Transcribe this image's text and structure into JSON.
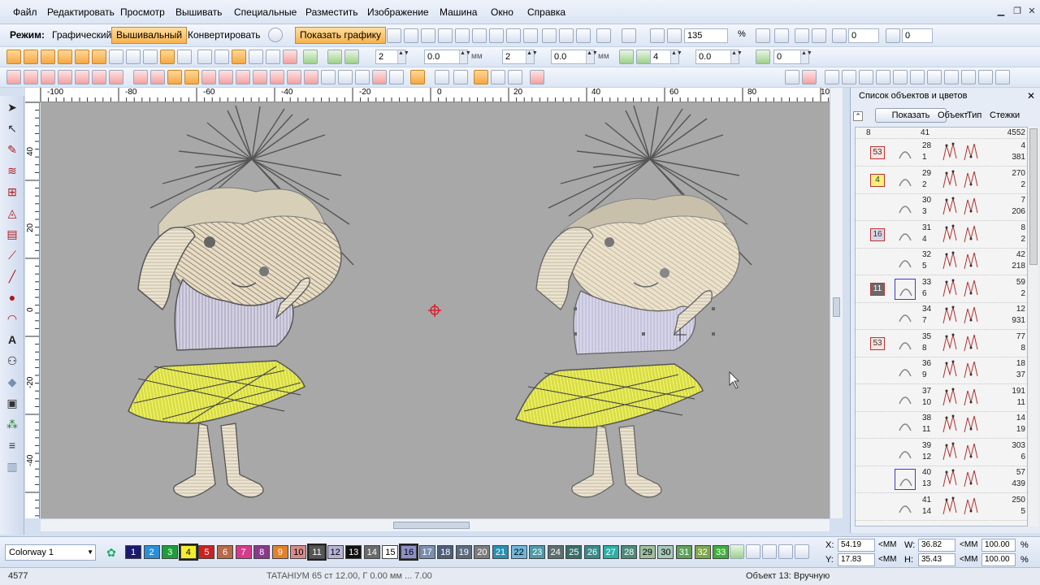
{
  "menu": {
    "items": [
      "Файл",
      "Редактировать",
      "Просмотр",
      "Вышивать",
      "Специальные",
      "Разместить",
      "Изображение",
      "Машина",
      "Окно",
      "Справка"
    ]
  },
  "toolbar": {
    "mode_label": "Режим:",
    "mode_graphic": "Графический",
    "mode_embroidery": "Вышивальный",
    "mode_convert": "Конвертировать",
    "show_graphic": "Показать графику",
    "zoom_value": "135",
    "zoom_unit": "%",
    "rotate_value": "0",
    "slant_value": "0",
    "field_a": "2",
    "field_b": "0.0",
    "unit_mm": "мм",
    "field_c": "2",
    "field_d": "0.0",
    "field_e": "4",
    "field_f": "0.0",
    "field_g": "0"
  },
  "ruler": {
    "h_labels": [
      "-100",
      "-80",
      "-60",
      "-40",
      "-20",
      "0",
      "20",
      "40",
      "60",
      "80",
      "100"
    ],
    "v_labels": [
      "40",
      "20",
      "0",
      "-20",
      "-40"
    ]
  },
  "panel": {
    "title": "Список объектов и цветов",
    "show_button": "Показать",
    "col_object": "Объект",
    "col_type": "Тип",
    "col_stitches": "Стежки",
    "first_row_num": "8",
    "first_row_count": "41",
    "first_row_stitches": "4552",
    "rows": [
      {
        "group": "53",
        "obj": "28",
        "sub": "1",
        "st1": "4",
        "st2": "381"
      },
      {
        "group": "4",
        "obj": "29",
        "sub": "2",
        "st1": "270",
        "st2": "2"
      },
      {
        "group": "",
        "obj": "30",
        "sub": "3",
        "st1": "7",
        "st2": "206"
      },
      {
        "group": "16",
        "obj": "31",
        "sub": "4",
        "st1": "8",
        "st2": "2"
      },
      {
        "group": "",
        "obj": "32",
        "sub": "5",
        "st1": "42",
        "st2": "218"
      },
      {
        "group": "11",
        "obj": "33",
        "sub": "6",
        "st1": "59",
        "st2": "2"
      },
      {
        "group": "",
        "obj": "34",
        "sub": "7",
        "st1": "12",
        "st2": "931"
      },
      {
        "group": "53",
        "obj": "35",
        "sub": "8",
        "st1": "77",
        "st2": "8"
      },
      {
        "group": "",
        "obj": "36",
        "sub": "9",
        "st1": "18",
        "st2": "37"
      },
      {
        "group": "",
        "obj": "37",
        "sub": "10",
        "st1": "191",
        "st2": "11"
      },
      {
        "group": "",
        "obj": "38",
        "sub": "11",
        "st1": "14",
        "st2": "19"
      },
      {
        "group": "",
        "obj": "39",
        "sub": "12",
        "st1": "303",
        "st2": "6"
      },
      {
        "group": "",
        "obj": "40",
        "sub": "13",
        "st1": "57",
        "st2": "439"
      },
      {
        "group": "",
        "obj": "41",
        "sub": "14",
        "st1": "250",
        "st2": "5"
      }
    ]
  },
  "palette": {
    "colorway": "Colorway 1",
    "swatches": [
      {
        "n": "1",
        "color": "#1c1a6e",
        "text": "#ffffff"
      },
      {
        "n": "2",
        "color": "#2a8fd6",
        "text": "#ffffff"
      },
      {
        "n": "3",
        "color": "#1f9d3a",
        "text": "#ffffff"
      },
      {
        "n": "4",
        "color": "#f2ef2a",
        "text": "#000000"
      },
      {
        "n": "5",
        "color": "#cc2222",
        "text": "#ffffff"
      },
      {
        "n": "6",
        "color": "#b86a4a",
        "text": "#ffffff"
      },
      {
        "n": "7",
        "color": "#d63b8a",
        "text": "#ffffff"
      },
      {
        "n": "8",
        "color": "#8a3a8a",
        "text": "#ffffff"
      },
      {
        "n": "9",
        "color": "#e3822a",
        "text": "#ffffff"
      },
      {
        "n": "10",
        "color": "#d88a8a",
        "text": "#000000"
      },
      {
        "n": "11",
        "color": "#555555",
        "text": "#ffffff"
      },
      {
        "n": "12",
        "color": "#b7b2d6",
        "text": "#000000"
      },
      {
        "n": "13",
        "color": "#111111",
        "text": "#ffffff"
      },
      {
        "n": "14",
        "color": "#6a6a6a",
        "text": "#ffffff"
      },
      {
        "n": "15",
        "color": "#ffffff",
        "text": "#000000"
      },
      {
        "n": "16",
        "color": "#8d8fc8",
        "text": "#000000"
      },
      {
        "n": "17",
        "color": "#7a8fb0",
        "text": "#ffffff"
      },
      {
        "n": "18",
        "color": "#4d5e7a",
        "text": "#ffffff"
      },
      {
        "n": "19",
        "color": "#5c6a80",
        "text": "#ffffff"
      },
      {
        "n": "20",
        "color": "#7c7c7c",
        "text": "#ffffff"
      },
      {
        "n": "21",
        "color": "#2a8fb0",
        "text": "#ffffff"
      },
      {
        "n": "22",
        "color": "#6fb8dc",
        "text": "#000000"
      },
      {
        "n": "23",
        "color": "#4c9aa8",
        "text": "#ffffff"
      },
      {
        "n": "24",
        "color": "#5e6e6e",
        "text": "#ffffff"
      },
      {
        "n": "25",
        "color": "#3a6e6a",
        "text": "#ffffff"
      },
      {
        "n": "26",
        "color": "#3a8a8a",
        "text": "#ffffff"
      },
      {
        "n": "27",
        "color": "#2ab0a8",
        "text": "#ffffff"
      },
      {
        "n": "28",
        "color": "#4c8a7a",
        "text": "#ffffff"
      },
      {
        "n": "29",
        "color": "#9fbfa0",
        "text": "#000000"
      },
      {
        "n": "30",
        "color": "#a8c8b8",
        "text": "#000000"
      },
      {
        "n": "31",
        "color": "#5fa05a",
        "text": "#ffffff"
      },
      {
        "n": "32",
        "color": "#7fa84a",
        "text": "#ffffff"
      },
      {
        "n": "33",
        "color": "#3fae3a",
        "text": "#ffffff"
      }
    ]
  },
  "coords": {
    "x_label": "X:",
    "x_value": "54.19",
    "x_unit": "<MM",
    "w_label": "W:",
    "w_value": "36.82",
    "w_unit": "<MM",
    "w_pct": "100.00",
    "pct_unit": "%",
    "y_label": "Y:",
    "y_value": "17.83",
    "y_unit": "<MM",
    "h_label": "H:",
    "h_value": "35.43",
    "h_unit": "<MM",
    "h_pct": "100.00"
  },
  "status": {
    "count": "4577",
    "thread_info": "TATAHIУM 65 ст 12.00, Г 0.00 мм ... 7.00",
    "object_info": "Объект 13: Вручную"
  }
}
